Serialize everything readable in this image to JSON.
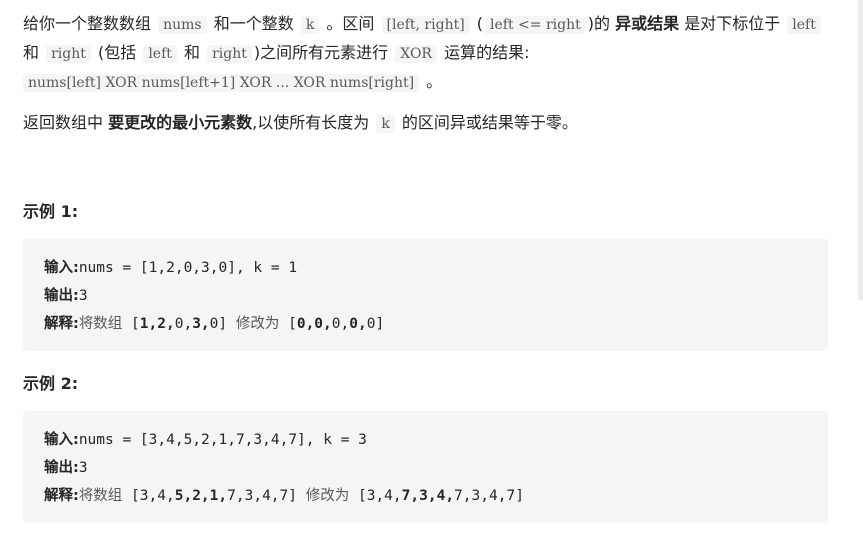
{
  "description": {
    "p1": {
      "t1": "给你一个整数数组",
      "c_nums": "nums",
      "t2": "和一个整数",
      "c_k": "k",
      "t3": "。区间",
      "c_range": "[left, right]",
      "t4": "(",
      "c_cond": "left <= right",
      "t5": ")的",
      "b_xor": "异或结果",
      "t6": "是对下标位于",
      "c_left1": "left",
      "t7": "和",
      "c_right1": "right",
      "t8": "(包括",
      "c_left2": "left",
      "t9": "和",
      "c_right2": "right",
      "t10": ")之间所有元素进行",
      "c_xor": "XOR",
      "t11": "运算的结果:",
      "c_expr": "nums[left] XOR nums[left+1] XOR ... XOR nums[right]",
      "t12": "。"
    },
    "p2": {
      "t1": "返回数组中",
      "b1": "要更改的最小元素数",
      "t2": ",以使所有长度为",
      "c_k": "k",
      "t3": "的区间异或结果等于零。"
    }
  },
  "examples": [
    {
      "title": "示例 1:",
      "input_label": "输入:",
      "input_value": "nums = [1,2,0,3,0], k = 1",
      "output_label": "输出:",
      "output_value": "3",
      "explain_label": "解释:",
      "explain_prefix": "将数组",
      "explain_middle": "修改为",
      "from_array": [
        {
          "v": "1",
          "bold": true
        },
        {
          "v": "2",
          "bold": true
        },
        {
          "v": "0",
          "bold": false
        },
        {
          "v": "3",
          "bold": true
        },
        {
          "v": "0",
          "bold": false
        }
      ],
      "to_array": [
        {
          "v": "0",
          "bold": true
        },
        {
          "v": "0",
          "bold": true
        },
        {
          "v": "0",
          "bold": false
        },
        {
          "v": "0",
          "bold": true
        },
        {
          "v": "0",
          "bold": false
        }
      ]
    },
    {
      "title": "示例 2:",
      "input_label": "输入:",
      "input_value": "nums = [3,4,5,2,1,7,3,4,7], k = 3",
      "output_label": "输出:",
      "output_value": "3",
      "explain_label": "解释:",
      "explain_prefix": "将数组",
      "explain_middle": "修改为",
      "from_array": [
        {
          "v": "3",
          "bold": false
        },
        {
          "v": "4",
          "bold": false
        },
        {
          "v": "5",
          "bold": true
        },
        {
          "v": "2",
          "bold": true
        },
        {
          "v": "1",
          "bold": true
        },
        {
          "v": "7",
          "bold": false
        },
        {
          "v": "3",
          "bold": false
        },
        {
          "v": "4",
          "bold": false
        },
        {
          "v": "7",
          "bold": false
        }
      ],
      "to_array": [
        {
          "v": "3",
          "bold": false
        },
        {
          "v": "4",
          "bold": false
        },
        {
          "v": "7",
          "bold": true
        },
        {
          "v": "3",
          "bold": true
        },
        {
          "v": "4",
          "bold": true
        },
        {
          "v": "7",
          "bold": false
        },
        {
          "v": "3",
          "bold": false
        },
        {
          "v": "4",
          "bold": false
        },
        {
          "v": "7",
          "bold": false
        }
      ]
    }
  ],
  "colors": {
    "text": "#262626",
    "code_bg": "#f5f5f5",
    "code_text": "#595959",
    "scrollbar": "#ececec"
  }
}
